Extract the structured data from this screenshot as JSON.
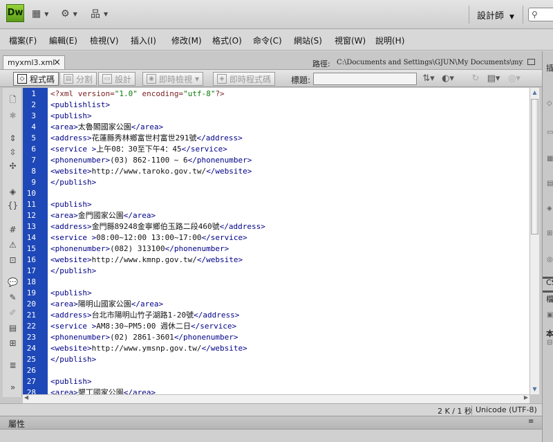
{
  "app": {
    "logo": "Dw",
    "workspace": "設計師",
    "search_placeholder": "",
    "icons": [
      "layout-icon",
      "gear-icon",
      "site-icon",
      "search-icon"
    ]
  },
  "menubar": {
    "items": [
      "檔案(F)",
      "編輯(E)",
      "檢視(V)",
      "插入(I)",
      "修改(M)",
      "格式(O)",
      "命令(C)",
      "網站(S)",
      "視窗(W)",
      "說明(H)"
    ]
  },
  "document": {
    "tab_name": "myxml3.xml",
    "path_label": "路徑:",
    "path_value": "C:\\Documents and Settings\\GJUN\\My Documents\\myxml3.xml"
  },
  "doc_toolbar": {
    "code_label": "程式碼",
    "split_label": "分割",
    "design_label": "設計",
    "live_view_label": "即時檢視",
    "live_code_label": "即時程式碼",
    "title_label": "標題:",
    "title_value": ""
  },
  "code": {
    "line_numbers": [
      "1",
      "2",
      "3",
      "4",
      "5",
      "6",
      "7",
      "8",
      "9",
      "10",
      "11",
      "12",
      "13",
      "14",
      "15",
      "16",
      "17",
      "18",
      "19",
      "20",
      "21",
      "22",
      "23",
      "24",
      "25",
      "26",
      "27",
      "28"
    ],
    "lines": [
      "<?xml version=\"1.0\" encoding=\"utf-8\"?>",
      "<publishlist>",
      "<publish>",
      "<area>太魯閣國家公園</area>",
      "<address>花蓮縣秀林鄉富世村富世291號</address>",
      "<service >上午08：30至下午4：45</service>",
      "<phonenumber>(03) 862-1100 ~ 6</phonenumber>",
      "<website>http://www.taroko.gov.tw/</website>",
      "</publish>",
      "",
      "<publish>",
      "<area>金門國家公園</area>",
      "<address>金門縣89248金寧鄉伯玉路二段460號</address>",
      "<service >08:00~12:00 13:00~17:00</service>",
      "<phonenumber>(082) 313100</phonenumber>",
      "<website>http://www.kmnp.gov.tw/</website>",
      "</publish>",
      "",
      "<publish>",
      "<area>陽明山國家公園</area>",
      "<address>台北市陽明山竹子湖路1-20號</address>",
      "<service >AM8:30~PM5:00 週休二日</service>",
      "<phonenumber>(02) 2861-3601</phonenumber>",
      "<website>http://www.ymsnp.gov.tw/</website>",
      "</publish>",
      "",
      "<publish>",
      "<area>墾丁國家公園</area>"
    ]
  },
  "status": {
    "size": "2 K / 1 秒",
    "encoding": "Unicode (UTF-8)"
  },
  "properties": {
    "label": "屬性"
  },
  "right_panel": {
    "insert_label": "插",
    "css_label": "CS",
    "files_label": "檔",
    "local_label": "本"
  },
  "colors": {
    "line_number_bg": "#1e48b8",
    "tag": "#000088",
    "value": "#0a7a0a"
  }
}
